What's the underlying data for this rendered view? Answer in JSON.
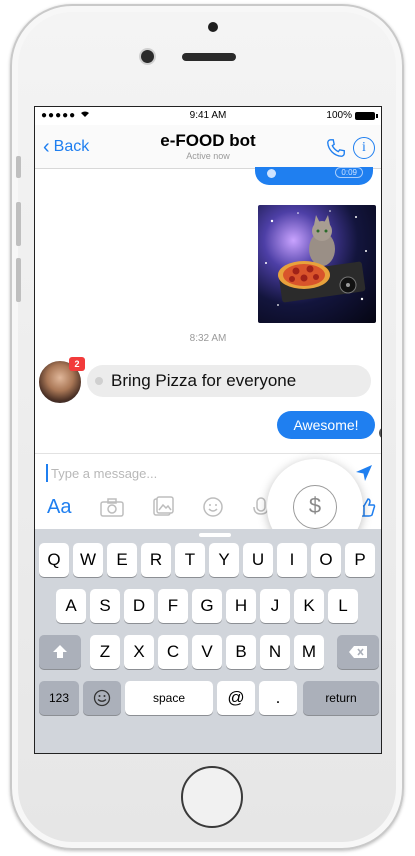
{
  "status": {
    "signal": "●●●●● ",
    "time": "9:41 AM",
    "battery": "100%"
  },
  "nav": {
    "back_label": "Back",
    "title": "e-FOOD bot",
    "subtitle": "Active now"
  },
  "thread": {
    "prev_time": "0:09",
    "timestamp": "8:32 AM",
    "avatar_badge": "2",
    "received_message": "Bring Pizza for everyone",
    "sent_message": "Awesome!"
  },
  "composer": {
    "placeholder": "Type a message..."
  },
  "toolbar": {
    "aa_label": "Aa",
    "money_symbol": "$"
  },
  "keyboard": {
    "row1": [
      "Q",
      "W",
      "E",
      "R",
      "T",
      "Y",
      "U",
      "I",
      "O",
      "P"
    ],
    "row2": [
      "A",
      "S",
      "D",
      "F",
      "G",
      "H",
      "J",
      "K",
      "L"
    ],
    "row3": [
      "Z",
      "X",
      "C",
      "V",
      "B",
      "N",
      "M"
    ],
    "numbers_label": "123",
    "space_label": "space",
    "at_label": "@",
    "period_label": ".",
    "return_label": "return"
  },
  "colors": {
    "accent": "#1f7ff0",
    "badge": "#f23b3b"
  }
}
